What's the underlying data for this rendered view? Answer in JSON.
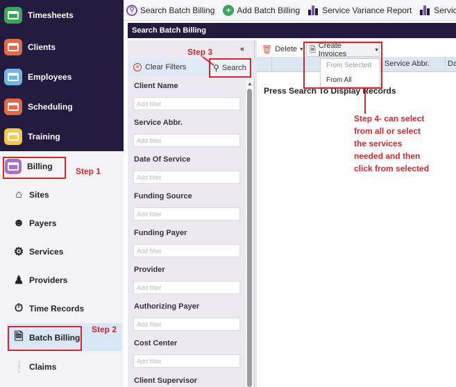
{
  "topbar": {
    "items": [
      {
        "label": "Search Batch Billing",
        "icon": "search-icon"
      },
      {
        "label": "Add Batch Billing",
        "icon": "plus-icon"
      },
      {
        "label": "Service Variance Report",
        "icon": "bar-chart-icon"
      },
      {
        "label": "Service Varianc",
        "icon": "bar-chart-icon"
      }
    ]
  },
  "sidebar": {
    "dark_items": [
      {
        "label": "Timesheets",
        "color": "#3aa55c"
      },
      {
        "label": "Clients",
        "color": "#e0694a"
      },
      {
        "label": "Employees",
        "color": "#6fb6e6"
      },
      {
        "label": "Scheduling",
        "color": "#e0694a"
      },
      {
        "label": "Training",
        "color": "#f2c94c"
      }
    ],
    "active_item": {
      "label": "Billing",
      "color": "#a96ec6"
    },
    "light_items": [
      {
        "label": "Sites",
        "icon": "house-icon"
      },
      {
        "label": "Payers",
        "icon": "payer-icon"
      },
      {
        "label": "Services",
        "icon": "services-icon"
      },
      {
        "label": "Providers",
        "icon": "providers-icon"
      },
      {
        "label": "Time Records",
        "icon": "time-records-icon"
      },
      {
        "label": "Batch Billing",
        "icon": "batch-billing-icon"
      },
      {
        "label": "Claims",
        "icon": "claims-icon"
      }
    ]
  },
  "panel": {
    "title": "Search Batch Billing",
    "clear_filters": "Clear Filters",
    "search": "Search",
    "collapse": "«",
    "filters": [
      {
        "label": "Client Name",
        "placeholder": "Add filter"
      },
      {
        "label": "Service Abbr.",
        "placeholder": "Add filter"
      },
      {
        "label": "Date Of Service",
        "placeholder": "Add filter"
      },
      {
        "label": "Funding Source",
        "placeholder": "Add filter"
      },
      {
        "label": "Funding Payer",
        "placeholder": "Add filter"
      },
      {
        "label": "Provider",
        "placeholder": "Add filter"
      },
      {
        "label": "Authorizing Payer",
        "placeholder": "Add filter"
      },
      {
        "label": "Cost Center",
        "placeholder": "Add filter"
      },
      {
        "label": "Client Supervisor",
        "placeholder": ""
      }
    ]
  },
  "results": {
    "delete": "Delete",
    "create_invoices": "Create Invoices",
    "dropdown": {
      "from_selected": "From Selected",
      "from_all": "From All"
    },
    "columns": [
      "Service Abbr.",
      "Da"
    ],
    "empty_message": "Press Search To Display Records"
  },
  "annotations": {
    "step1": "Step 1",
    "step2": "Step 2",
    "step3": "Step 3",
    "step4": [
      "Step 4- can select",
      "from all or select",
      "the services",
      "needed and then",
      "click from selected"
    ]
  },
  "colors": {
    "nav_dark": "#241a3f",
    "annotation_red": "#d9232b",
    "header_blue": "#dde6f3"
  }
}
